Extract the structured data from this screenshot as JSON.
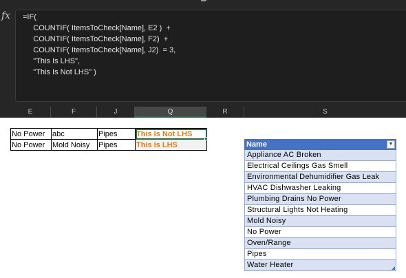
{
  "formula_bar": {
    "fx_label": "fx",
    "lines": [
      "=IF(",
      "     COUNTIF( ItemsToCheck[Name], E2 )  +",
      "     COUNTIF( ItemsToCheck[Name], F2)  +",
      "     COUNTIF( ItemsToCheck[Name], J2)  = 3,",
      "     \"This Is LHS\",",
      "     \"This Is Not LHS\" )"
    ]
  },
  "column_headers": [
    "E",
    "F",
    "J",
    "Q",
    "R",
    "S"
  ],
  "active_column": "Q",
  "data_rows": [
    {
      "e": "No Power",
      "f": "abc",
      "j": "Pipes",
      "q": "This Is Not LHS"
    },
    {
      "e": "No Power",
      "f": "Mold Noisy",
      "j": "Pipes",
      "q": "This Is LHS"
    }
  ],
  "excel_table": {
    "name": "ItemsToCheck",
    "header": "Name",
    "dropdown_icon": "chevron-down-icon",
    "rows": [
      "Appliance AC Broken",
      "Electrical Ceilings Gas Smell",
      "Environmental Dehumidifier Gas Leak",
      "HVAC Dishwasher Leaking",
      "Plumbing Drains No Power",
      "Structural Lights Not Heating",
      "Mold Noisy",
      "No Power",
      "Oven/Range",
      "Pipes",
      "Water Heater"
    ]
  },
  "colors": {
    "result_text": "#ea7a0b",
    "table_header": "#4472c4",
    "table_band": "#d9e1f2",
    "selection": "#1e7145"
  }
}
